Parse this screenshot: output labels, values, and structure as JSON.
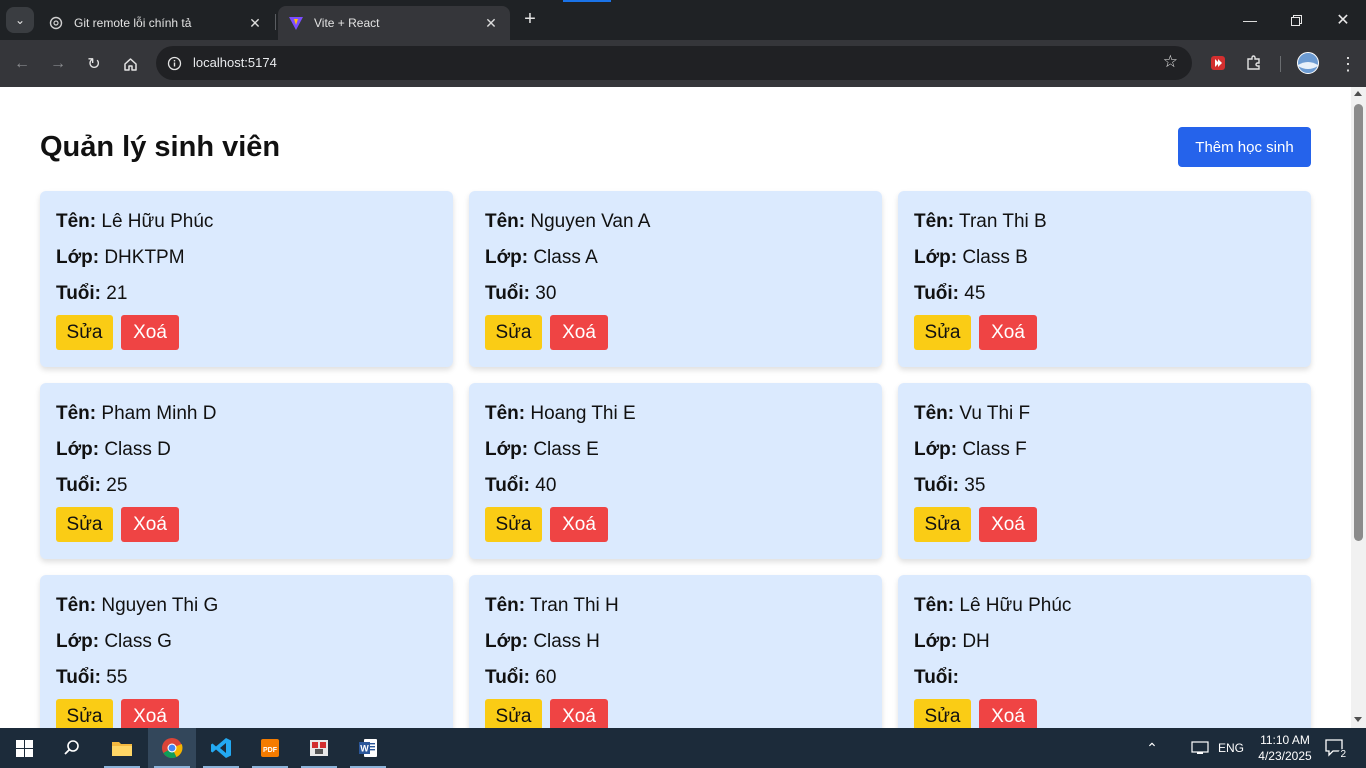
{
  "browser": {
    "tabs": [
      {
        "title": "Git remote lỗi chính tả",
        "active": false
      },
      {
        "title": "Vite + React",
        "active": true
      }
    ],
    "url": "localhost:5174",
    "accent_color": "#1a73e8"
  },
  "page": {
    "title": "Quản lý sinh viên",
    "add_button": "Thêm học sinh",
    "labels": {
      "name": "Tên:",
      "class": "Lớp:",
      "age": "Tuổi:"
    },
    "edit_label": "Sửa",
    "delete_label": "Xoá",
    "students": [
      {
        "name": "Lê Hữu Phúc",
        "class": "DHKTPM",
        "age": "21"
      },
      {
        "name": "Nguyen Van A",
        "class": "Class A",
        "age": "30"
      },
      {
        "name": "Tran Thi B",
        "class": "Class B",
        "age": "45"
      },
      {
        "name": "Pham  Minh D",
        "class": "Class D",
        "age": "25"
      },
      {
        "name": "Hoang Thi E",
        "class": "Class E",
        "age": "40"
      },
      {
        "name": "Vu Thi F",
        "class": "Class F",
        "age": "35"
      },
      {
        "name": "Nguyen Thi G",
        "class": "Class G",
        "age": "55"
      },
      {
        "name": "Tran Thi H",
        "class": "Class H",
        "age": "60"
      },
      {
        "name": "Lê Hữu Phúc",
        "class": "DH",
        "age": ""
      }
    ],
    "colors": {
      "card_bg": "#dbeafe",
      "add_button_bg": "#2563eb",
      "edit_bg": "#facc15",
      "delete_bg": "#ef4444"
    }
  },
  "taskbar": {
    "apps": [
      "file-explorer",
      "chrome",
      "vscode",
      "pdf-reader",
      "app-5",
      "word"
    ],
    "language": "ENG",
    "time": "11:10 AM",
    "date": "4/23/2025",
    "notification_count": "2"
  }
}
